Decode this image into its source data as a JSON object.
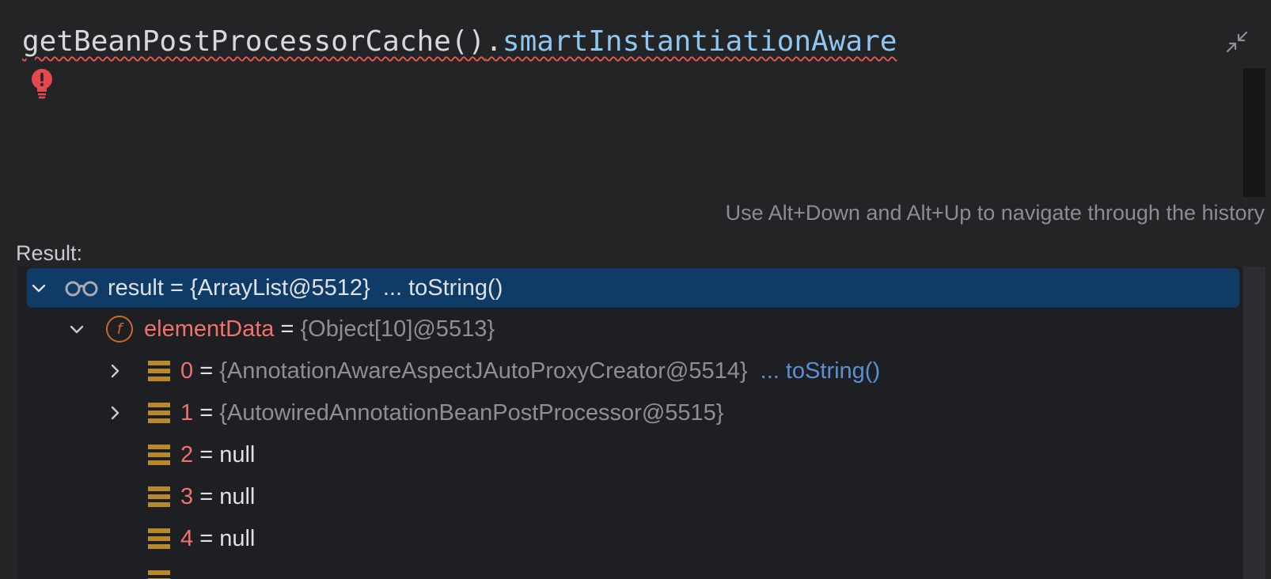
{
  "editor": {
    "expression_method": "getBeanPostProcessorCache()",
    "expression_dot": ".",
    "expression_field": "smartInstantiationAware",
    "collapse_icon": "collapse-arrows-icon",
    "error_icon": "error-bulb-icon",
    "hint": "Use Alt+Down and Alt+Up to navigate through the history"
  },
  "result": {
    "label": "Result:",
    "tree": {
      "root": {
        "icon": "watch-glasses-icon",
        "name": "result",
        "equals": " = ",
        "value": "{ArrayList@5512}",
        "link": "... toString()"
      },
      "element_data": {
        "icon": "field-icon",
        "icon_letter": "f",
        "name": "elementData",
        "equals": " = ",
        "value": "{Object[10]@5513}"
      },
      "items": [
        {
          "index": "0",
          "equals": " = ",
          "value": "{AnnotationAwareAspectJAutoProxyCreator@5514}",
          "link": "... toString()",
          "expandable": true
        },
        {
          "index": "1",
          "equals": " = ",
          "value": "{AutowiredAnnotationBeanPostProcessor@5515}",
          "link": "",
          "expandable": true
        },
        {
          "index": "2",
          "equals": " = ",
          "value": "null",
          "link": "",
          "expandable": false
        },
        {
          "index": "3",
          "equals": " = ",
          "value": "null",
          "link": "",
          "expandable": false
        },
        {
          "index": "4",
          "equals": " = ",
          "value": "null",
          "link": "",
          "expandable": false
        }
      ]
    }
  },
  "colors": {
    "background": "#232426",
    "tree_background": "#1e1f22",
    "selection": "#0f3b67",
    "field_name": "#f1726d",
    "link": "#5b8fd6",
    "error": "#e0554f"
  }
}
